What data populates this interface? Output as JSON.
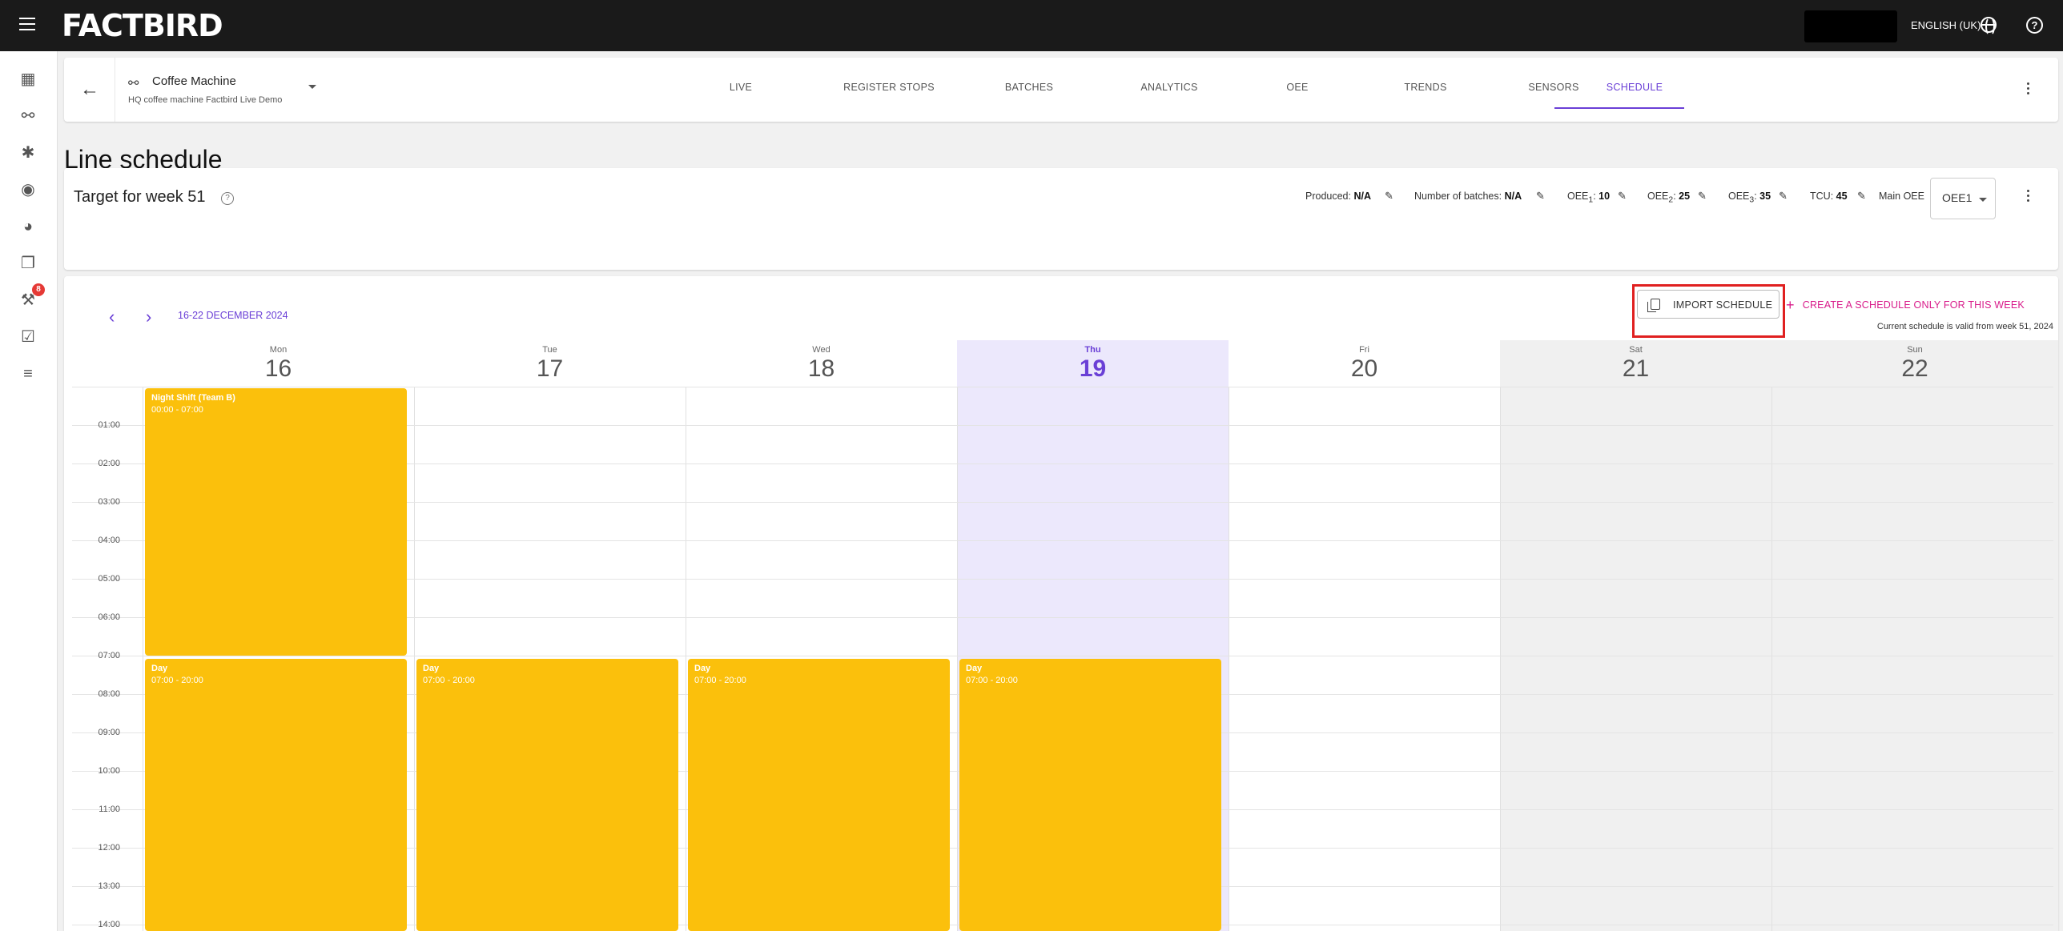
{
  "app": {
    "brand": "FACTBIRD",
    "language": "ENGLISH (UK)"
  },
  "sidebar": {
    "badge_count": "8",
    "items": [
      {
        "name": "factory-icon"
      },
      {
        "name": "line-icon"
      },
      {
        "name": "sensor-icon"
      },
      {
        "name": "dashboard-icon"
      },
      {
        "name": "gauge-icon"
      },
      {
        "name": "documents-icon"
      },
      {
        "name": "maintenance-icon"
      },
      {
        "name": "checklist-icon"
      },
      {
        "name": "tasks-icon"
      }
    ]
  },
  "header": {
    "line_name": "Coffee Machine",
    "line_sub": "HQ coffee machine Factbird Live Demo",
    "tabs": [
      "LIVE",
      "REGISTER STOPS",
      "BATCHES",
      "ANALYTICS",
      "OEE",
      "TRENDS",
      "SENSORS",
      "SCHEDULE"
    ],
    "active_tab": "SCHEDULE"
  },
  "page_title": "Line schedule",
  "target": {
    "title": "Target for week 51",
    "produced_label": "Produced:",
    "produced_value": "N/A",
    "batches_label": "Number of batches:",
    "batches_value": "N/A",
    "oee1_label": "OEE",
    "oee1_sub": "1",
    "oee1_value": "10",
    "oee2_label": "OEE",
    "oee2_sub": "2",
    "oee2_value": "25",
    "oee3_label": "OEE",
    "oee3_sub": "3",
    "oee3_value": "35",
    "tcu_label": "TCU:",
    "tcu_value": "45",
    "main_oee_label": "Main OEE",
    "main_oee_value": "OEE1"
  },
  "schedule": {
    "week_range": "16-22 DECEMBER 2024",
    "import_label": "IMPORT SCHEDULE",
    "create_label": "CREATE A SCHEDULE ONLY FOR THIS WEEK",
    "valid_text": "Current schedule is valid from week 51, 2024",
    "days": [
      {
        "name": "Mon",
        "date": "16"
      },
      {
        "name": "Tue",
        "date": "17"
      },
      {
        "name": "Wed",
        "date": "18"
      },
      {
        "name": "Thu",
        "date": "19"
      },
      {
        "name": "Fri",
        "date": "20"
      },
      {
        "name": "Sat",
        "date": "21"
      },
      {
        "name": "Sun",
        "date": "22"
      }
    ],
    "hours": [
      "01:00",
      "02:00",
      "03:00",
      "04:00",
      "05:00",
      "06:00",
      "07:00",
      "08:00",
      "09:00",
      "10:00",
      "11:00",
      "12:00",
      "13:00",
      "14:00"
    ],
    "events": [
      {
        "title": "Night Shift (Team B)",
        "time": "00:00 - 07:00"
      },
      {
        "title": "Day",
        "time": "07:00 - 20:00"
      },
      {
        "title": "Day",
        "time": "07:00 - 20:00"
      },
      {
        "title": "Day",
        "time": "07:00 - 20:00"
      },
      {
        "title": "Day",
        "time": "07:00 - 20:00"
      }
    ]
  },
  "colors": {
    "accent": "#6a3fd6",
    "create": "#d81b8a",
    "event": "#fbc00c",
    "highlight": "#e02020",
    "topbar": "#1a1a1a"
  }
}
